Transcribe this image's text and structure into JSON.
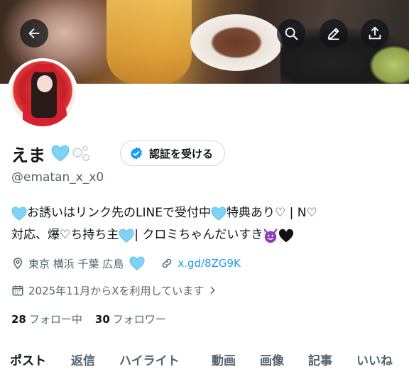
{
  "profile": {
    "name": "えま",
    "handle": "@ematan_x_x0",
    "verify_label": "認証を受ける",
    "bio_line1": {
      "part1": "お誘いはリンク先のLINEで受付中",
      "part2": " 特典あり♡ | N♡"
    },
    "bio_line2": {
      "part1": "対応、爆♡ち持ち主 ",
      "part2": " | クロミちゃんだいすき"
    },
    "location": "東京 横浜 千葉 広島",
    "link": "x.gd/8ZG9K",
    "joined": "2025年11月からXを利用しています",
    "following_count": "28",
    "following_label": "フォロー中",
    "followers_count": "30",
    "followers_label": "フォロワー"
  },
  "tabs": [
    "ポスト",
    "返信",
    "ハイライト",
    "動画",
    "画像",
    "記事",
    "いいね"
  ],
  "icons": {
    "back": "back-arrow-icon",
    "search": "search-icon",
    "edit": "edit-pencil-icon",
    "share": "share-upload-icon",
    "verified": "verified-badge-icon",
    "location": "location-pin-icon",
    "link": "link-icon",
    "calendar": "calendar-icon",
    "chevron": "chevron-right-icon",
    "heart_blue": "light-blue-heart-emoji",
    "bubbles": "bubbles-emoji",
    "devil": "smiling-devil-emoji",
    "heart_black": "black-heart-emoji"
  },
  "colors": {
    "text_primary": "#0f1419",
    "text_secondary": "#536471",
    "link": "#1d9bf0",
    "verified": "#1d9bf0",
    "heart_blue": "#7fd3f5",
    "devil": "#8b3fb8"
  }
}
